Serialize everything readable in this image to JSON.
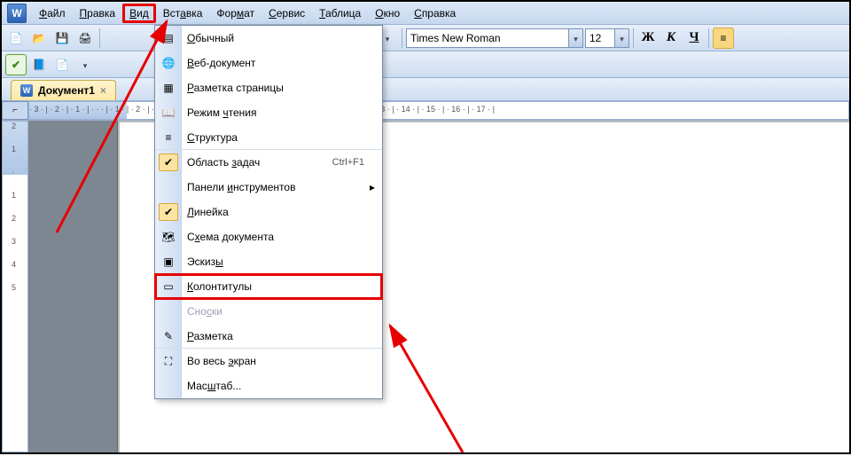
{
  "menubar": {
    "items": [
      {
        "label": "Файл",
        "u": 0
      },
      {
        "label": "Правка",
        "u": 0
      },
      {
        "label": "Вид",
        "u": 0,
        "open": true,
        "highlight": true
      },
      {
        "label": "Вставка",
        "u": 3
      },
      {
        "label": "Формат",
        "u": 3
      },
      {
        "label": "Сервис",
        "u": 0
      },
      {
        "label": "Таблица",
        "u": 0
      },
      {
        "label": "Окно",
        "u": 0
      },
      {
        "label": "Справка",
        "u": 0
      }
    ]
  },
  "toolbar": {
    "font_name": "Times New Roman",
    "font_size": "12",
    "bold": "Ж",
    "italic": "К",
    "underline": "Ч"
  },
  "doc_tab": {
    "label": "Документ1"
  },
  "hruler_text": "· 3 · | · 2 · | · 1 · | · · · | · 1 · | · 2 · | · 3 · | · 4 · | · 5 · | · 6 · | · 7 · | · 8 · | · 9 · | · 10 · | · 11 · | · 12 · | · 13 · | · 14 · | · 15 · | · 16 · | · 17 · |",
  "vruler_labels": [
    "2",
    "1",
    "",
    "1",
    "2",
    "3",
    "4",
    "5"
  ],
  "view_menu": [
    {
      "label": "Обычный",
      "u": 0,
      "icon": "page-icon"
    },
    {
      "label": "Веб-документ",
      "u": 0,
      "icon": "web-icon"
    },
    {
      "label": "Разметка страницы",
      "u": 0,
      "icon": "layout-icon"
    },
    {
      "label": "Режим чтения",
      "u": 6,
      "icon": "reading-icon"
    },
    {
      "label": "Структура",
      "u": 0,
      "icon": "outline-icon",
      "sep": true
    },
    {
      "label": "Область задач",
      "u": 8,
      "shortcut": "Ctrl+F1",
      "checked": true
    },
    {
      "label": "Панели инструментов",
      "u": 7,
      "submenu": true
    },
    {
      "label": "Линейка",
      "u": 0,
      "checked": true
    },
    {
      "label": "Схема документа",
      "u": 1,
      "icon": "map-icon"
    },
    {
      "label": "Эскизы",
      "u": 5,
      "icon": "thumbs-icon",
      "sep": true
    },
    {
      "label": "Колонтитулы",
      "u": 0,
      "icon": "headerfooter-icon",
      "highlight": true,
      "sep": true
    },
    {
      "label": "Сноски",
      "u": 3,
      "disabled": true
    },
    {
      "label": "Разметка",
      "u": 0,
      "icon": "markup-icon",
      "sep": true
    },
    {
      "label": "Во весь экран",
      "u": 8,
      "icon": "fullscreen-icon"
    },
    {
      "label": "Масштаб...",
      "u": 3
    }
  ]
}
